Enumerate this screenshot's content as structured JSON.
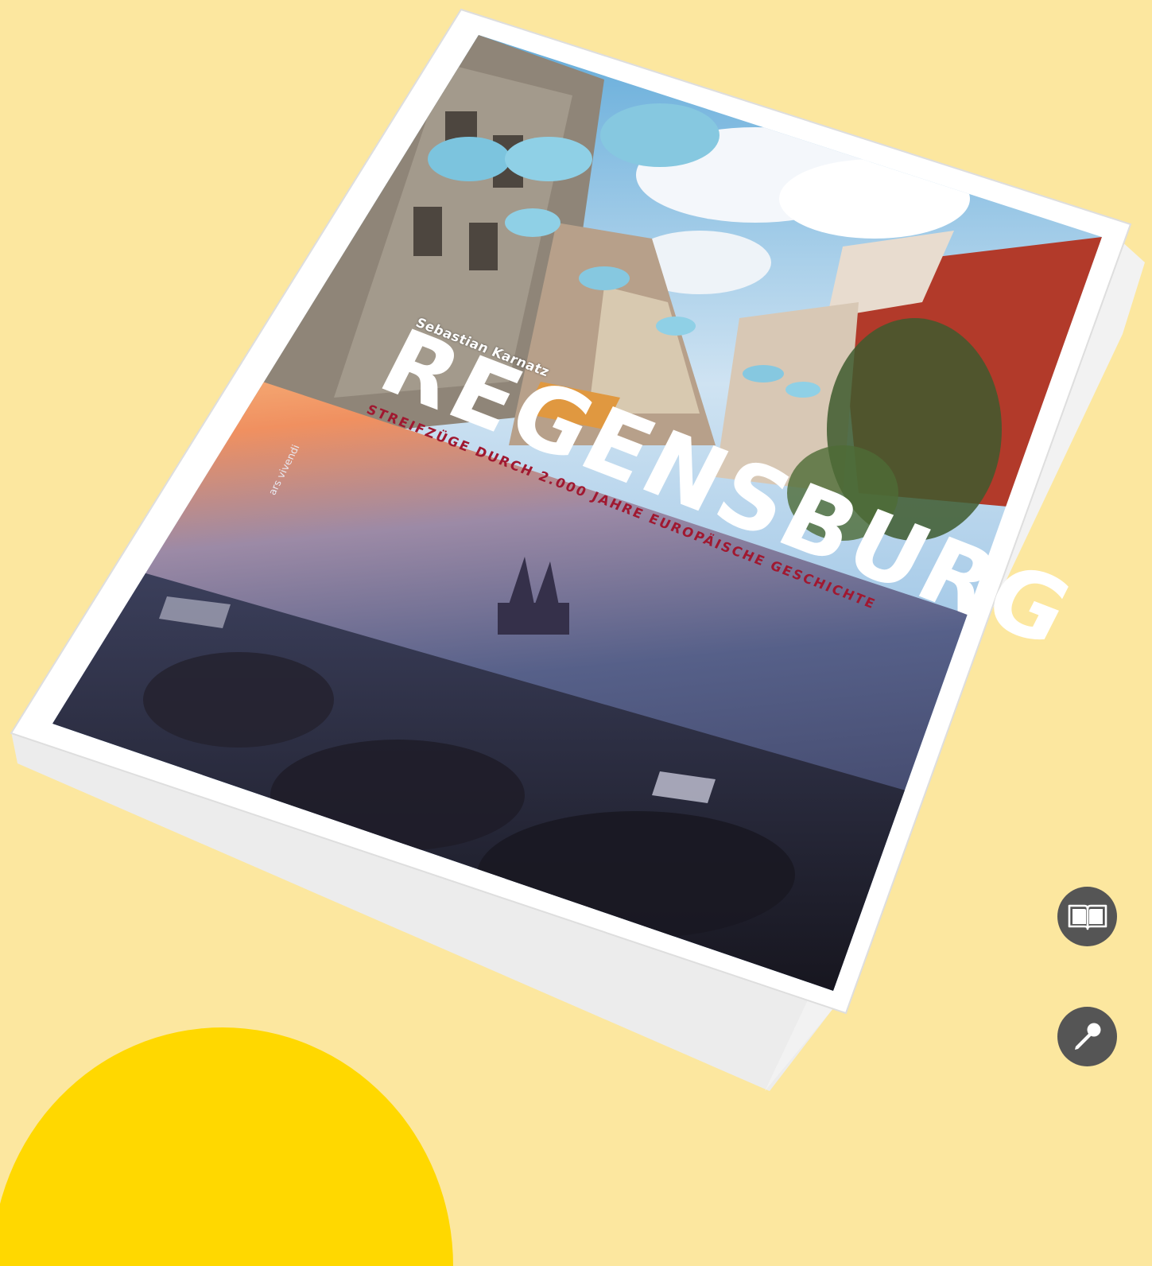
{
  "page": {
    "background_color": "#FCE79F",
    "accent_color": "#FFD800"
  },
  "book": {
    "author": "Sebastian Karnatz",
    "title": "REGENSBURG",
    "subtitle": "STREIFZÜGE DURCH 2.000 JAHRE EUROPÄISCHE GESCHICHTE",
    "publisher": "ars vivendi",
    "subtitle_color": "#A01830"
  },
  "actions": {
    "read_icon": "open-book-icon",
    "listen_icon": "microphone-icon",
    "button_color": "#555555"
  }
}
